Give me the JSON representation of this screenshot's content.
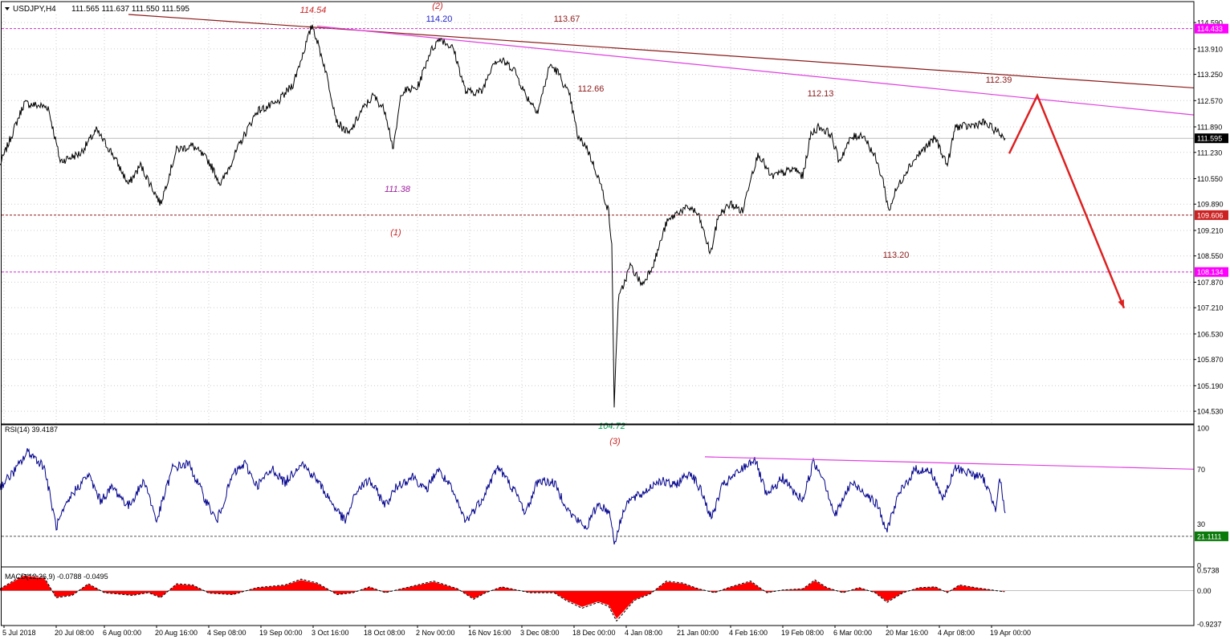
{
  "header": {
    "symbol_tf": "USDJPY,H4",
    "ohlc": "111.565 111.637 111.550 111.595"
  },
  "rsi_label": "RSI(14) 39.4187",
  "macd_label": "MACD(12,26,9) -0.0788 -0.0495",
  "colors": {
    "price": "#000000",
    "rsi": "#00008b",
    "macd_hist": "#ff0000",
    "trend_dark": "#8b1a1a",
    "trend_magenta": "#e040e0",
    "arrow": "#dd2020",
    "hline": "#cc33cc",
    "grid": "#c8c8c8"
  },
  "chart_data": [
    {
      "type": "line",
      "name": "price",
      "ylim": [
        104.2,
        114.8
      ],
      "yticks": [
        "114.590",
        "113.910",
        "113.250",
        "112.570",
        "111.890",
        "111.230",
        "110.550",
        "109.890",
        "109.210",
        "108.550",
        "107.870",
        "107.210",
        "106.530",
        "105.870",
        "105.190",
        "104.530"
      ],
      "xlabels": [
        "5 Jul 2018",
        "20 Jul 08:00",
        "6 Aug 00:00",
        "20 Aug 16:00",
        "4 Sep 08:00",
        "19 Sep 00:00",
        "3 Oct 16:00",
        "18 Oct 08:00",
        "2 Nov 00:00",
        "16 Nov 16:00",
        "3 Dec 08:00",
        "18 Dec 00:00",
        "4 Jan 08:00",
        "21 Jan 00:00",
        "4 Feb 16:00",
        "19 Feb 08:00",
        "6 Mar 00:00",
        "20 Mar 16:00",
        "4 Apr 08:00",
        "19 Apr 00:00"
      ],
      "price_tags": [
        {
          "label": "114.433",
          "value": 114.433,
          "color": "#ff00ff"
        },
        {
          "label": "111.595",
          "value": 111.595,
          "color": "#000000"
        },
        {
          "label": "109.606",
          "value": 109.606,
          "color": "#cc2222"
        },
        {
          "label": "108.134",
          "value": 108.134,
          "color": "#ff00ff"
        }
      ],
      "annotations": [
        {
          "label": "114.54",
          "color": "#cc2222",
          "italic": true
        },
        {
          "label": "(2)",
          "color": "#cc2222",
          "italic": true
        },
        {
          "label": "114.20",
          "color": "#2222cc",
          "italic": false
        },
        {
          "label": "113.67",
          "color": "#8b1a1a",
          "italic": false
        },
        {
          "label": "112.66",
          "color": "#8b1a1a",
          "italic": false
        },
        {
          "label": "112.13",
          "color": "#8b1a1a",
          "italic": false
        },
        {
          "label": "112.39",
          "color": "#8b1a1a",
          "italic": false
        },
        {
          "label": "111.38",
          "color": "#a020a0",
          "italic": true
        },
        {
          "label": "(1)",
          "color": "#cc2222",
          "italic": true
        },
        {
          "label": "113.20",
          "color": "#8b1a1a",
          "italic": false
        },
        {
          "label": "104.72",
          "color": "#00a050",
          "italic": true
        },
        {
          "label": "(3)",
          "color": "#cc2222",
          "italic": true
        }
      ],
      "anchors": [
        [
          0,
          110.9
        ],
        [
          30,
          112.5
        ],
        [
          60,
          112.4
        ],
        [
          75,
          111.0
        ],
        [
          100,
          111.2
        ],
        [
          120,
          111.8
        ],
        [
          140,
          111.2
        ],
        [
          160,
          110.4
        ],
        [
          175,
          110.9
        ],
        [
          200,
          109.9
        ],
        [
          220,
          111.3
        ],
        [
          240,
          111.4
        ],
        [
          260,
          111.0
        ],
        [
          275,
          110.4
        ],
        [
          300,
          111.5
        ],
        [
          320,
          112.3
        ],
        [
          345,
          112.5
        ],
        [
          365,
          113.0
        ],
        [
          389,
          114.54
        ],
        [
          405,
          113.4
        ],
        [
          420,
          112.0
        ],
        [
          435,
          111.7
        ],
        [
          450,
          112.3
        ],
        [
          465,
          112.7
        ],
        [
          480,
          112.3
        ],
        [
          490,
          111.3
        ],
        [
          500,
          112.8
        ],
        [
          520,
          112.9
        ],
        [
          535,
          113.8
        ],
        [
          548,
          114.2
        ],
        [
          565,
          113.9
        ],
        [
          580,
          112.8
        ],
        [
          600,
          112.8
        ],
        [
          615,
          113.6
        ],
        [
          625,
          113.6
        ],
        [
          640,
          113.4
        ],
        [
          655,
          112.7
        ],
        [
          670,
          112.3
        ],
        [
          685,
          113.5
        ],
        [
          695,
          113.3
        ],
        [
          710,
          112.66
        ],
        [
          720,
          111.6
        ],
        [
          730,
          111.4
        ],
        [
          745,
          110.6
        ],
        [
          758,
          109.7
        ],
        [
          762,
          108.8
        ],
        [
          765,
          104.72
        ],
        [
          770,
          107.4
        ],
        [
          785,
          108.3
        ],
        [
          800,
          107.8
        ],
        [
          815,
          108.4
        ],
        [
          830,
          109.4
        ],
        [
          845,
          109.7
        ],
        [
          860,
          109.8
        ],
        [
          870,
          109.6
        ],
        [
          885,
          108.6
        ],
        [
          895,
          109.6
        ],
        [
          910,
          109.9
        ],
        [
          925,
          109.7
        ],
        [
          935,
          110.6
        ],
        [
          945,
          111.2
        ],
        [
          960,
          110.6
        ],
        [
          975,
          110.7
        ],
        [
          990,
          110.8
        ],
        [
          1000,
          110.6
        ],
        [
          1010,
          111.7
        ],
        [
          1020,
          111.9
        ],
        [
          1035,
          111.7
        ],
        [
          1045,
          111.0
        ],
        [
          1060,
          111.6
        ],
        [
          1075,
          111.7
        ],
        [
          1090,
          111.1
        ],
        [
          1100,
          110.5
        ],
        [
          1107,
          109.7
        ],
        [
          1115,
          110.2
        ],
        [
          1130,
          110.8
        ],
        [
          1145,
          111.2
        ],
        [
          1165,
          111.6
        ],
        [
          1180,
          110.9
        ],
        [
          1190,
          111.9
        ],
        [
          1205,
          111.9
        ],
        [
          1225,
          112.0
        ],
        [
          1240,
          111.8
        ],
        [
          1252,
          111.595
        ]
      ],
      "forecast_path": [
        [
          1257,
          111.2
        ],
        [
          1292,
          112.7
        ],
        [
          1400,
          107.2
        ]
      ],
      "trendlines": [
        {
          "color": "#8b1a1a",
          "from": [
            160,
            114.8
          ],
          "to": [
            1487,
            112.9
          ]
        },
        {
          "color": "#e040e0",
          "from": [
            395,
            114.5
          ],
          "to": [
            1487,
            112.2
          ]
        }
      ],
      "hlines": [
        {
          "value": 114.433,
          "color": "#cc33cc"
        },
        {
          "value": 109.606,
          "color": "#8b1a1a"
        },
        {
          "value": 108.134,
          "color": "#cc33cc"
        }
      ]
    },
    {
      "type": "line",
      "name": "RSI(14)",
      "ylim": [
        0,
        100
      ],
      "yticks": [
        "100",
        "70",
        "30",
        "0"
      ],
      "level_tag": {
        "label": "21.1111",
        "value": 21.1111
      },
      "trendline": {
        "color": "#e040e0",
        "from": [
          878,
          79
        ],
        "to": [
          1487,
          70
        ]
      },
      "anchors": [
        [
          0,
          57
        ],
        [
          20,
          70
        ],
        [
          35,
          83
        ],
        [
          55,
          72
        ],
        [
          70,
          28
        ],
        [
          90,
          52
        ],
        [
          110,
          66
        ],
        [
          125,
          47
        ],
        [
          140,
          57
        ],
        [
          160,
          43
        ],
        [
          180,
          62
        ],
        [
          195,
          32
        ],
        [
          215,
          71
        ],
        [
          235,
          74
        ],
        [
          255,
          49
        ],
        [
          270,
          32
        ],
        [
          290,
          66
        ],
        [
          305,
          74
        ],
        [
          320,
          58
        ],
        [
          340,
          70
        ],
        [
          355,
          60
        ],
        [
          375,
          75
        ],
        [
          395,
          62
        ],
        [
          415,
          44
        ],
        [
          430,
          32
        ],
        [
          445,
          55
        ],
        [
          460,
          62
        ],
        [
          480,
          44
        ],
        [
          495,
          58
        ],
        [
          515,
          65
        ],
        [
          530,
          54
        ],
        [
          545,
          70
        ],
        [
          560,
          58
        ],
        [
          580,
          32
        ],
        [
          600,
          48
        ],
        [
          620,
          72
        ],
        [
          640,
          55
        ],
        [
          655,
          38
        ],
        [
          670,
          62
        ],
        [
          690,
          60
        ],
        [
          710,
          38
        ],
        [
          730,
          27
        ],
        [
          745,
          45
        ],
        [
          760,
          38
        ],
        [
          765,
          16
        ],
        [
          780,
          46
        ],
        [
          800,
          52
        ],
        [
          820,
          62
        ],
        [
          840,
          58
        ],
        [
          860,
          68
        ],
        [
          875,
          52
        ],
        [
          886,
          34
        ],
        [
          900,
          58
        ],
        [
          920,
          68
        ],
        [
          940,
          78
        ],
        [
          955,
          50
        ],
        [
          975,
          64
        ],
        [
          990,
          52
        ],
        [
          1000,
          48
        ],
        [
          1013,
          75
        ],
        [
          1025,
          65
        ],
        [
          1040,
          36
        ],
        [
          1060,
          60
        ],
        [
          1080,
          52
        ],
        [
          1095,
          42
        ],
        [
          1103,
          24
        ],
        [
          1120,
          52
        ],
        [
          1140,
          70
        ],
        [
          1160,
          68
        ],
        [
          1175,
          48
        ],
        [
          1190,
          71
        ],
        [
          1205,
          68
        ],
        [
          1225,
          63
        ],
        [
          1240,
          42
        ],
        [
          1245,
          65
        ],
        [
          1252,
          38
        ]
      ]
    },
    {
      "type": "area",
      "name": "MACD(12,26,9)",
      "ylim": [
        -0.9237,
        0.5738
      ],
      "yticks": [
        "0.5738",
        "0.00",
        "-0.9237"
      ],
      "anchors": [
        [
          0,
          0.05
        ],
        [
          30,
          0.42
        ],
        [
          55,
          0.35
        ],
        [
          70,
          -0.18
        ],
        [
          90,
          -0.12
        ],
        [
          110,
          0.18
        ],
        [
          130,
          -0.05
        ],
        [
          165,
          -0.12
        ],
        [
          185,
          -0.05
        ],
        [
          200,
          -0.18
        ],
        [
          220,
          0.18
        ],
        [
          240,
          0.15
        ],
        [
          260,
          -0.06
        ],
        [
          290,
          -0.1
        ],
        [
          320,
          0.08
        ],
        [
          355,
          0.15
        ],
        [
          375,
          0.3
        ],
        [
          395,
          0.2
        ],
        [
          420,
          -0.1
        ],
        [
          440,
          -0.05
        ],
        [
          460,
          0.1
        ],
        [
          480,
          -0.05
        ],
        [
          500,
          0.05
        ],
        [
          540,
          0.25
        ],
        [
          570,
          0.05
        ],
        [
          590,
          -0.22
        ],
        [
          605,
          -0.05
        ],
        [
          625,
          0.1
        ],
        [
          660,
          -0.05
        ],
        [
          690,
          -0.05
        ],
        [
          705,
          -0.25
        ],
        [
          725,
          -0.45
        ],
        [
          745,
          -0.3
        ],
        [
          758,
          -0.4
        ],
        [
          768,
          -0.78
        ],
        [
          790,
          -0.25
        ],
        [
          810,
          -0.08
        ],
        [
          830,
          0.25
        ],
        [
          850,
          0.2
        ],
        [
          870,
          0.05
        ],
        [
          890,
          -0.05
        ],
        [
          910,
          0.1
        ],
        [
          935,
          0.25
        ],
        [
          955,
          -0.05
        ],
        [
          975,
          0.02
        ],
        [
          1000,
          0.05
        ],
        [
          1015,
          0.28
        ],
        [
          1030,
          0.08
        ],
        [
          1050,
          -0.05
        ],
        [
          1070,
          0.08
        ],
        [
          1090,
          -0.05
        ],
        [
          1105,
          -0.3
        ],
        [
          1125,
          -0.05
        ],
        [
          1145,
          0.08
        ],
        [
          1165,
          0.1
        ],
        [
          1180,
          -0.05
        ],
        [
          1195,
          0.15
        ],
        [
          1215,
          0.08
        ],
        [
          1235,
          0.02
        ],
        [
          1252,
          -0.03
        ]
      ]
    }
  ]
}
